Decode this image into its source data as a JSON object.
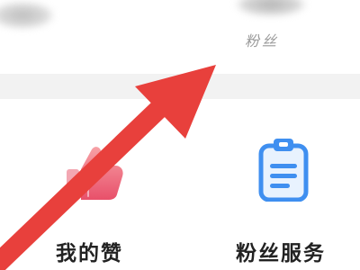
{
  "stats": {
    "fans_label": "粉丝"
  },
  "services": {
    "my_likes_label": "我的赞",
    "fan_service_label": "粉丝服务"
  },
  "icons": {
    "likes": "thumbs-up-icon",
    "fan_service": "clipboard-icon"
  },
  "colors": {
    "arrow": "#e8403c",
    "likes_icon": "#f06a78",
    "fan_service_icon": "#3f8ff0",
    "separator": "#f2f2f2"
  }
}
